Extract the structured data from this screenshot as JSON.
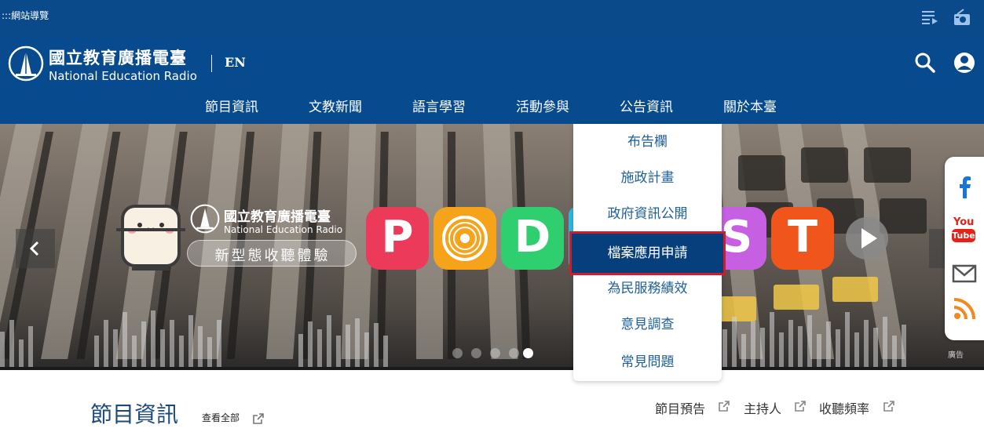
{
  "topbar": {
    "site_nav_label": ":::網站導覽",
    "playlist_icon": "playlist-icon",
    "radio_icon": "radio-icon"
  },
  "header": {
    "logo_name_cn": "國立教育廣播電臺",
    "logo_name_en": "National Education Radio",
    "lang_label": "EN",
    "search_icon": "search-icon",
    "user_icon": "user-icon",
    "nav": [
      {
        "label": "節目資訊"
      },
      {
        "label": "文教新聞"
      },
      {
        "label": "語言學習"
      },
      {
        "label": "活動參與"
      },
      {
        "label": "公告資訊"
      },
      {
        "label": "關於本臺"
      }
    ]
  },
  "dropdown": {
    "parent": "公告資訊",
    "items": [
      {
        "label": "布告欄"
      },
      {
        "label": "施政計畫"
      },
      {
        "label": "政府資訊公開"
      },
      {
        "label": "檔案應用申請",
        "active": true
      },
      {
        "label": "為民服務績效"
      },
      {
        "label": "意見調查"
      },
      {
        "label": "常見問題"
      }
    ]
  },
  "banner": {
    "logo_cn": "國立教育廣播電臺",
    "logo_en": "National Education Radio",
    "tagline": "新型態收聽體驗",
    "podcast_letters": [
      "P",
      "",
      "D",
      "",
      "S",
      "T"
    ],
    "ad_tag": "廣告",
    "prev_icon": "chevron-left-icon",
    "next_icon": "chevron-right-icon",
    "dot_count": 5,
    "active_dot": 4
  },
  "social": [
    "facebook-icon",
    "youtube-icon",
    "mail-icon",
    "rss-icon"
  ],
  "youtube_text": {
    "top": "You",
    "bottom": "Tube"
  },
  "section": {
    "title": "節目資訊",
    "view_all": "查看全部",
    "links": [
      {
        "label": "節目預告"
      },
      {
        "label": "主持人"
      },
      {
        "label": "收聽頻率"
      }
    ]
  },
  "colors": {
    "header_blue": "#074a8e",
    "dropdown_text": "#1e5f95",
    "active_bg": "#063f7c",
    "highlight_border": "#d11a2a",
    "section_title": "#1d4a78"
  }
}
